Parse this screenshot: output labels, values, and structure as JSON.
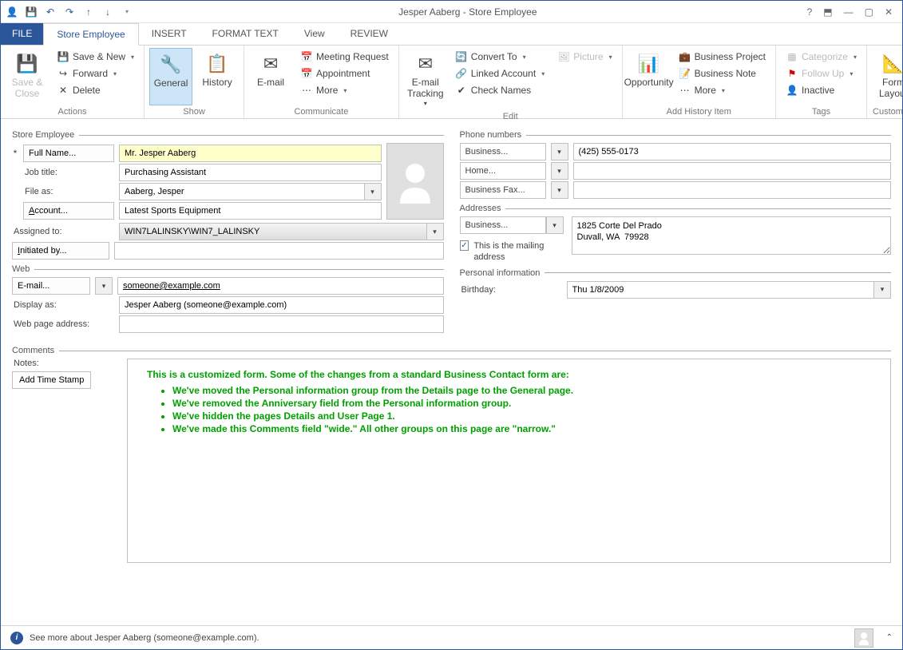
{
  "window_title": "Jesper Aaberg - Store Employee",
  "tabs": {
    "file": "FILE",
    "store_employee": "Store Employee",
    "insert": "INSERT",
    "format_text": "FORMAT TEXT",
    "view": "View",
    "review": "REVIEW"
  },
  "ribbon": {
    "actions": {
      "save_close": "Save & Close",
      "save_new": "Save & New",
      "forward": "Forward",
      "delete": "Delete",
      "label": "Actions"
    },
    "show": {
      "general": "General",
      "history": "History",
      "label": "Show"
    },
    "communicate": {
      "email": "E-mail",
      "meeting": "Meeting Request",
      "appointment": "Appointment",
      "more": "More",
      "label": "Communicate"
    },
    "edit": {
      "tracking": "E-mail Tracking",
      "convert": "Convert To",
      "linked": "Linked Account",
      "check": "Check Names",
      "picture": "Picture",
      "label": "Edit"
    },
    "history": {
      "opportunity": "Opportunity",
      "bproject": "Business Project",
      "bnote": "Business Note",
      "more": "More",
      "label": "Add History Item"
    },
    "tags": {
      "categorize": "Categorize",
      "followup": "Follow Up",
      "inactive": "Inactive",
      "label": "Tags"
    },
    "customize": {
      "layout": "Form Layout",
      "label": "Customize"
    }
  },
  "sections": {
    "store_employee": "Store Employee",
    "web": "Web",
    "comments": "Comments",
    "phone": "Phone numbers",
    "addresses": "Addresses",
    "personal": "Personal information"
  },
  "fields": {
    "full_name_btn": "Full Name...",
    "full_name": "Mr. Jesper Aaberg",
    "job_title_lbl": "Job title:",
    "job_title": "Purchasing Assistant",
    "file_as_lbl": "File as:",
    "file_as": "Aaberg, Jesper",
    "account_btn": "Account...",
    "account": "Latest Sports Equipment",
    "assigned_lbl": "Assigned to:",
    "assigned": "WIN7LALINSKY\\WIN7_LALINSKY",
    "initiated_btn": "Initiated by...",
    "initiated": "",
    "email_btn": "E-mail...",
    "email": "someone@example.com",
    "display_as_lbl": "Display as:",
    "display_as": "Jesper Aaberg (someone@example.com)",
    "web_lbl": "Web page address:",
    "web": "",
    "phone_business_btn": "Business...",
    "phone_business": "(425) 555-0173",
    "phone_home_btn": "Home...",
    "phone_home": "",
    "phone_fax_btn": "Business Fax...",
    "phone_fax": "",
    "addr_business_btn": "Business...",
    "address": "1825 Corte Del Prado\nDuvall, WA  79928",
    "mailing_chk": "This is the mailing address",
    "birthday_lbl": "Birthday:",
    "birthday": "Thu 1/8/2009",
    "notes_lbl": "Notes:",
    "timestamp_btn": "Add Time Stamp"
  },
  "notes_body": {
    "intro": "This is a customized form. Some of the changes from a standard Business Contact form are:",
    "bullets": [
      "We've moved the Personal information group from the Details page to the General page.",
      "We've removed the Anniversary field from the Personal information group.",
      "We've hidden the pages Details and User Page 1.",
      "We've made this Comments field \"wide.\" All other groups on this page are \"narrow.\""
    ]
  },
  "status": "See more about Jesper Aaberg (someone@example.com)."
}
